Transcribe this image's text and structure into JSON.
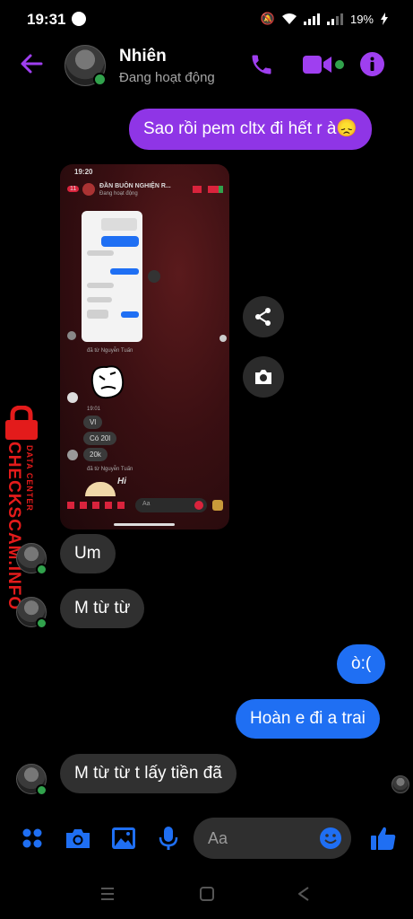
{
  "status": {
    "time": "19:31",
    "battery": "19%"
  },
  "header": {
    "name": "Nhiên",
    "presence": "Đang hoạt động"
  },
  "messages": {
    "m1": "Sao rồi pem cltx đi hết r à😞",
    "m2": "Um",
    "m3": "M từ từ",
    "m4": "ò:(",
    "m5": "Hoàn e đi a trai",
    "m6": "M từ từ t lấy tiền đã"
  },
  "shot": {
    "time": "19:20",
    "badge": "11",
    "title": "ĐẦN BUÔN NGHIỆN R...",
    "subtitle": "Đang hoạt động",
    "sender1": "đã từ Nguyễn Tuấn",
    "sender2": "đã từ Nguyễn Tuấn",
    "time_label": "19:01",
    "b1": "Vl",
    "b2": "Có 20l",
    "b3": "20k",
    "hi": "Hi",
    "aa": "Aa"
  },
  "composer": {
    "placeholder": "Aa"
  },
  "watermark": {
    "brand": "CHECKSCAM.INFO",
    "tag": "DATA CENTER"
  },
  "colors": {
    "accent": "#9f3ff0",
    "blue": "#1f6ff3",
    "online": "#31a24c",
    "watermark": "#e31b1b"
  }
}
